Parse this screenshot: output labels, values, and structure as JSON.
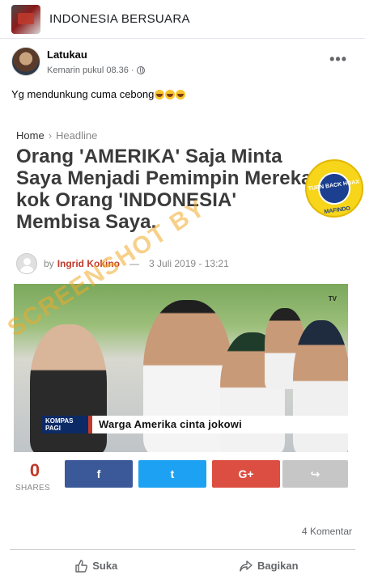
{
  "group": {
    "name": "INDONESIA BERSUARA"
  },
  "post": {
    "author": "Latukau",
    "time": "Kemarin pukul 08.36",
    "separator": "·",
    "text": "Yg mendunkung cuma cebong",
    "emoji_count": 3,
    "more_label": "•••"
  },
  "shared_article": {
    "breadcrumb": [
      "Home",
      "Headline"
    ],
    "headline": "Orang 'AMERIKA' Saja Minta Saya Menjadi Pemimpin Mereka kok Orang 'INDONESIA' Membisa Saya.",
    "byline_prefix": "by",
    "author": "Ingrid Kokino",
    "date": "3 Juli 2019 - 13:21",
    "seal": {
      "ring_text": "MASYARAKAT ANTIFITNAH INDONESIA",
      "center_text": "TURN BACK HOAX",
      "bottom_text": "MAFINDO"
    },
    "video": {
      "tv_logo": "TV",
      "channel": "KOMPAS",
      "program": "PAGI",
      "caption": "Warga Amerika cinta jokowi"
    },
    "share": {
      "count": "0",
      "label": "SHARES",
      "buttons": [
        "f",
        "t",
        "G+",
        "↪"
      ]
    },
    "watermark": "SCREENSHOT BY"
  },
  "comments": {
    "count_label": "4 Komentar"
  },
  "actions": {
    "like": "Suka",
    "share": "Bagikan"
  },
  "colors": {
    "facebook": "#3b5998",
    "twitter": "#1da1f2",
    "google_plus": "#dc4e41",
    "share_gray": "#c6c6c6",
    "accent_red": "#c0392b",
    "seal_yellow": "#f6d51a"
  }
}
